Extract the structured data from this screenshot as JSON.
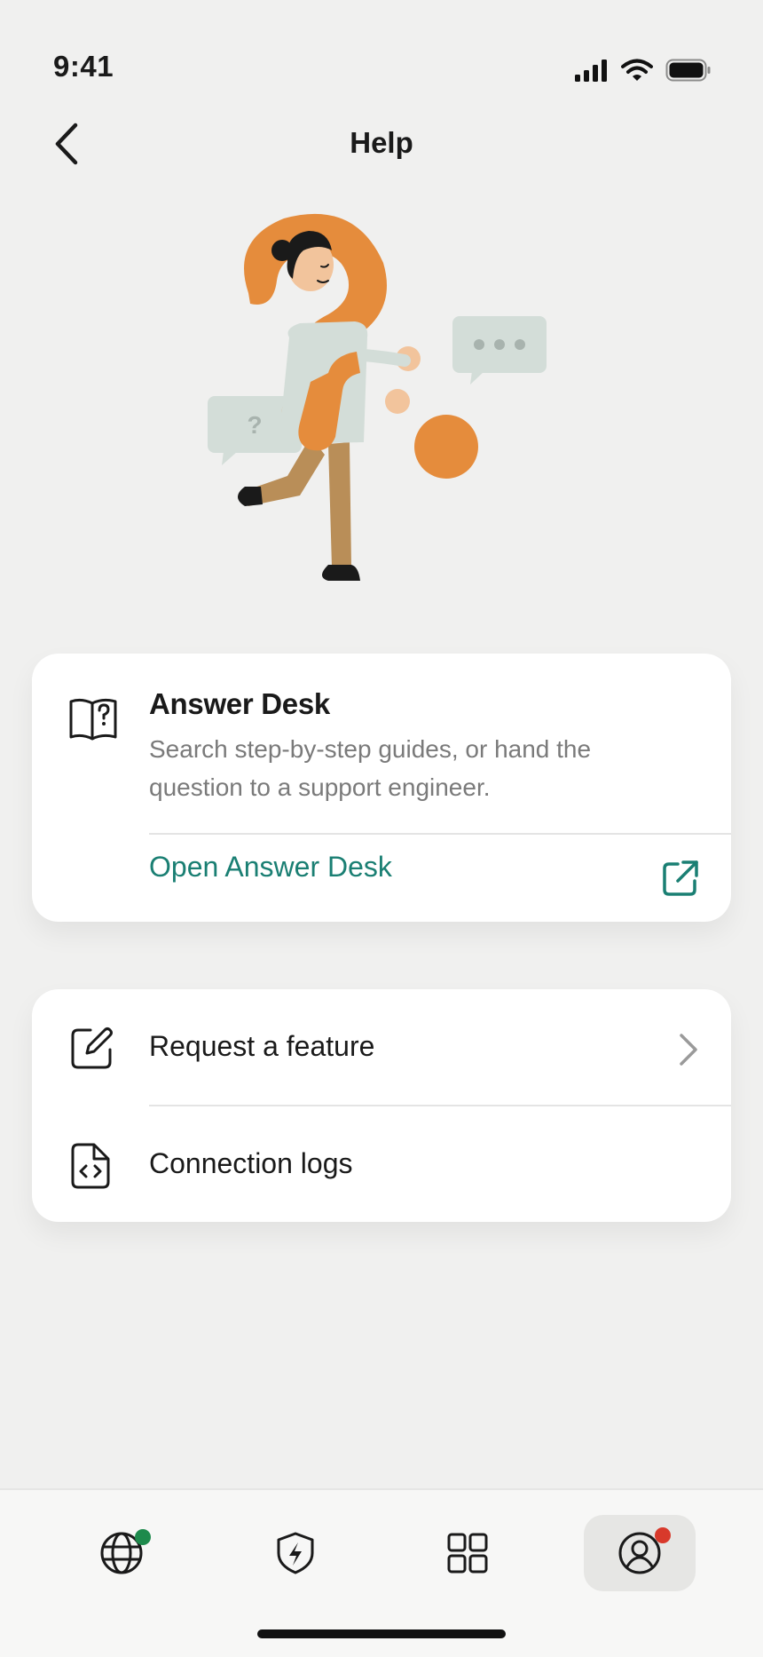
{
  "status_bar": {
    "time": "9:41"
  },
  "nav": {
    "title": "Help"
  },
  "answer_desk": {
    "title": "Answer Desk",
    "description": "Search step-by-step guides, or hand the question to a support engineer.",
    "link_label": "Open Answer Desk",
    "illustration_bubble_glyph": "?"
  },
  "list": {
    "items": [
      {
        "label": "Request a feature",
        "icon": "edit-icon",
        "has_chevron": true
      },
      {
        "label": "Connection logs",
        "icon": "file-code-icon",
        "has_chevron": false
      }
    ]
  },
  "tabbar": {
    "tabs": [
      {
        "icon": "globe-icon",
        "badge_color": "#1e8a4c",
        "active": false
      },
      {
        "icon": "shield-bolt-icon",
        "active": false
      },
      {
        "icon": "grid-icon",
        "active": false
      },
      {
        "icon": "user-circle-icon",
        "badge_color": "#d8392b",
        "active": true
      }
    ]
  },
  "colors": {
    "accent": "#1a7f73",
    "orange": "#e58c3c",
    "background": "#f0f0ef"
  }
}
